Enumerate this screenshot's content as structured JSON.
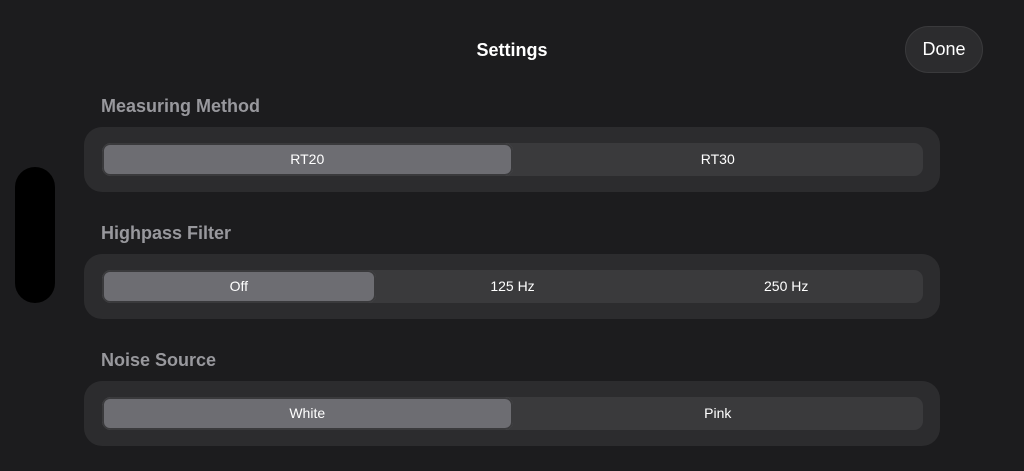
{
  "header": {
    "title": "Settings",
    "done_label": "Done"
  },
  "sections": [
    {
      "title": "Measuring Method",
      "options": [
        "RT20",
        "RT30"
      ],
      "selected": "RT20"
    },
    {
      "title": "Highpass Filter",
      "options": [
        "Off",
        "125 Hz",
        "250 Hz"
      ],
      "selected": "Off"
    },
    {
      "title": "Noise Source",
      "options": [
        "White",
        "Pink"
      ],
      "selected": "White"
    }
  ],
  "colors": {
    "background": "#1c1c1e",
    "card": "#2c2c2e",
    "segment_track": "#3a3a3c",
    "segment_selected": "#6d6d72",
    "section_title": "#98989d"
  }
}
